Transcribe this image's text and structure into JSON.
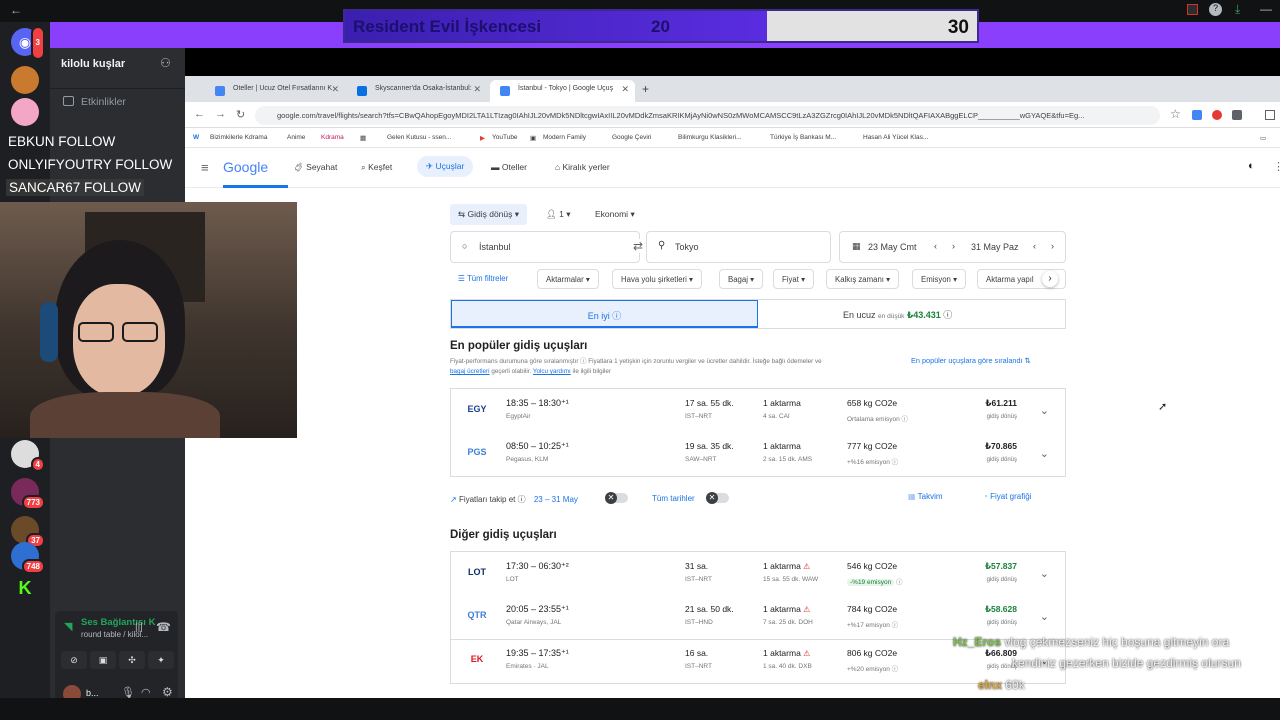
{
  "stream_overlay": {
    "vote_title": "Resident Evil İşkencesi",
    "vote_left": "20",
    "vote_right": "30",
    "follows": [
      "EBKUN FOLLOW",
      "ONLYIFYOUTRY FOLLOW",
      "SANCAR67 FOLLOW"
    ],
    "chat": [
      {
        "user": "Hz_Eros",
        "text": "vlog çekmezseniz hiç boşuna gitmeyin ora"
      },
      {
        "user": "",
        "text": "kendiniz gezerken bizide gezdirmiş olursun"
      },
      {
        "user": "elnx",
        "text": "60k"
      }
    ]
  },
  "discord": {
    "server_name": "kilolu kuşlar",
    "events_label": "Etkinlikler",
    "voice_status": "Ses Bağlantısı K",
    "voice_channel": "round table / kilol...",
    "username": "b...",
    "guild_badges": [
      "3",
      "4",
      "773",
      "37",
      "748"
    ]
  },
  "browser": {
    "tabs": [
      {
        "label": "Oteller | Ucuz Otel Fırsatlarını K",
        "color": "#1a73e8"
      },
      {
        "label": "Skyscanner'da Osaka-İstanbul: ",
        "color": "#0770e3"
      },
      {
        "label": "İstanbul - Tokyo | Google Uçuş",
        "color": "#4285f4"
      }
    ],
    "url": "google.com/travel/flights/search?tfs=CBwQAhopEgoyMDI2LTA1LTIzag0IAhIJL20vMDk5NDltcgwIAxIIL20vMDdkZmsaKRIKMjAyNi0wNS0zMWoMCAMSCC9tLzA3ZGZrcg0IAhIJL20vMDk5NDltQAFIAXABggELCP__________wGYAQE&tfu=Eg...",
    "bookmarks": [
      "Bizimkilerle Kdrama",
      "Anime",
      "Kdrama",
      "Gelen Kutusu - ssen...",
      "YouTube",
      "Modern Family",
      "Google Çeviri",
      "Bilimkurgu Klasikleri...",
      "Türkiye İş Bankası M...",
      "Hasan Ali Yücel Klas..."
    ]
  },
  "gnav": {
    "logo": "Google",
    "items": [
      "Seyahat",
      "Keşfet",
      "Uçuşlar",
      "Oteller",
      "Kiralık yerler"
    ]
  },
  "search": {
    "trip_type": "Gidiş dönüş",
    "passengers": "1",
    "cabin": "Ekonomi",
    "from": "İstanbul",
    "to": "Tokyo",
    "depart": "23 May Cmt",
    "return": "31 May Paz",
    "filters": [
      "Tüm filtreler",
      "Aktarmalar",
      "Hava yolu şirketleri",
      "Bagaj",
      "Fiyat",
      "Kalkış zamanı",
      "Emisyon",
      "Aktarma yapıl"
    ]
  },
  "sort": {
    "best": "En iyi",
    "cheapest": "En ucuz",
    "cheapest_from": "en düşük",
    "cheapest_price": "₺43.431"
  },
  "popular": {
    "title": "En popüler gidiş uçuşları",
    "note1": "Fiyat-performans durumuna göre sıralanmıştır",
    "note2": "Fiyatlara 1 yetişkin için zorunlu vergiler ve ücretler dahildir. İsteğe bağlı ödemeler ve",
    "note3": "bagaj ücretleri",
    "note4": "geçerli olabilir.",
    "note5": "Yolcu yardımı",
    "note6": "ile ilgili bilgiler",
    "sorted_by": "En popüler uçuşlara göre sıralandı",
    "flights": [
      {
        "logo": "EGY",
        "logo_color": "#1d3f8f",
        "time": "18:35 – 18:30⁺¹",
        "airline": "EgyptAir",
        "duration": "17 sa. 55 dk.",
        "route": "IST–NRT",
        "stops": "1 aktarma",
        "stop_detail": "4 sa. CAI",
        "warn": false,
        "co2": "658 kg CO2e",
        "co2_detail": "Ortalama emisyon",
        "eco": false,
        "price": "₺61.211",
        "green": false
      },
      {
        "logo": "PGS",
        "logo_color": "#3d7fd6",
        "time": "08:50 – 10:25⁺¹",
        "airline": "Pegasus, KLM",
        "duration": "19 sa. 35 dk.",
        "route": "SAW–NRT",
        "stops": "1 aktarma",
        "stop_detail": "2 sa. 15 dk. AMS",
        "warn": false,
        "co2": "777 kg CO2e",
        "co2_detail": "+%16 emisyon",
        "eco": false,
        "price": "₺70.865",
        "green": false
      }
    ]
  },
  "tracking": {
    "label": "Fiyatları takip et",
    "dates": "23 – 31 May",
    "all_dates": "Tüm tarihler",
    "calendar": "Takvim",
    "chart": "Fiyat grafiği"
  },
  "other": {
    "title": "Diğer gidiş uçuşları",
    "price_label": "gidiş dönüş",
    "flights": [
      {
        "logo": "LOT",
        "logo_color": "#0b2f6b",
        "time": "17:30 – 06:30⁺²",
        "airline": "LOT",
        "duration": "31 sa.",
        "route": "IST–NRT",
        "stops": "1 aktarma",
        "stop_detail": "15 sa. 55 dk. WAW",
        "warn": true,
        "co2": "546 kg CO2e",
        "co2_detail": "-%19 emisyon",
        "eco": true,
        "price": "₺57.837",
        "green": true
      },
      {
        "logo": "QTR",
        "logo_color": "#3d7fd6",
        "time": "20:05 – 23:55⁺¹",
        "airline": "Qatar Airways, JAL",
        "duration": "21 sa. 50 dk.",
        "route": "IST–HND",
        "stops": "1 aktarma",
        "stop_detail": "7 sa. 25 dk. DOH",
        "warn": true,
        "co2": "784 kg CO2e",
        "co2_detail": "+%17 emisyon",
        "eco": false,
        "price": "₺58.628",
        "green": true
      },
      {
        "logo": "EK",
        "logo_color": "#d71921",
        "time": "19:35 – 17:35⁺¹",
        "airline": "Emirates · JAL",
        "duration": "16 sa.",
        "route": "IST–NRT",
        "stops": "1 aktarma",
        "stop_detail": "1 sa. 40 dk. DXB",
        "warn": true,
        "co2": "806 kg CO2e",
        "co2_detail": "+%20 emisyon",
        "eco": false,
        "price": "₺66.809",
        "green": false
      }
    ]
  }
}
